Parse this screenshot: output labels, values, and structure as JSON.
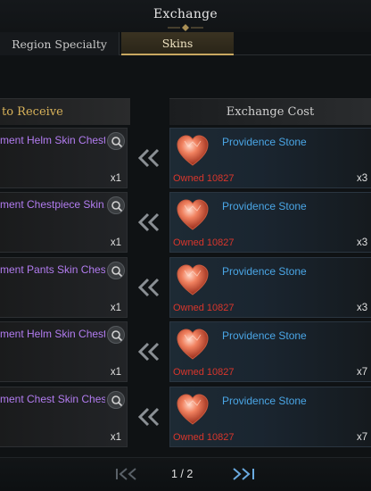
{
  "window": {
    "title": "Exchange"
  },
  "tabs": [
    {
      "label": "Region Specialty",
      "active": false
    },
    {
      "label": "Skins",
      "active": true
    }
  ],
  "columns": {
    "receive": "to Receive",
    "cost": "Exchange Cost"
  },
  "rows": [
    {
      "item": "ment Helm Skin Chest",
      "qty": "x1",
      "cost_item": "Providence Stone",
      "owned": "Owned 10827",
      "cost_qty": "x3"
    },
    {
      "item": "ment Chestpiece Skin.",
      "qty": "x1",
      "cost_item": "Providence Stone",
      "owned": "Owned 10827",
      "cost_qty": "x3"
    },
    {
      "item": "ment Pants Skin Chest",
      "qty": "x1",
      "cost_item": "Providence Stone",
      "owned": "Owned 10827",
      "cost_qty": "x3"
    },
    {
      "item": "ment Helm Skin Chest",
      "qty": "x1",
      "cost_item": "Providence Stone",
      "owned": "Owned 10827",
      "cost_qty": "x7"
    },
    {
      "item": "ment Chest Skin Chest",
      "qty": "x1",
      "cost_item": "Providence Stone",
      "owned": "Owned 10827",
      "cost_qty": "x7"
    }
  ],
  "pagination": {
    "text": "1 / 2"
  },
  "icons": {
    "preview": "magnifier-icon",
    "exchange": "double-chevron-left-icon",
    "currency": "providence-stone-icon",
    "first_page": "first-page-icon",
    "last_page": "last-page-icon"
  },
  "colors": {
    "accent_gold": "#d9b35a",
    "item_purple": "#b27cf0",
    "cost_blue": "#4aa6e6",
    "owned_red": "#d9362c"
  }
}
